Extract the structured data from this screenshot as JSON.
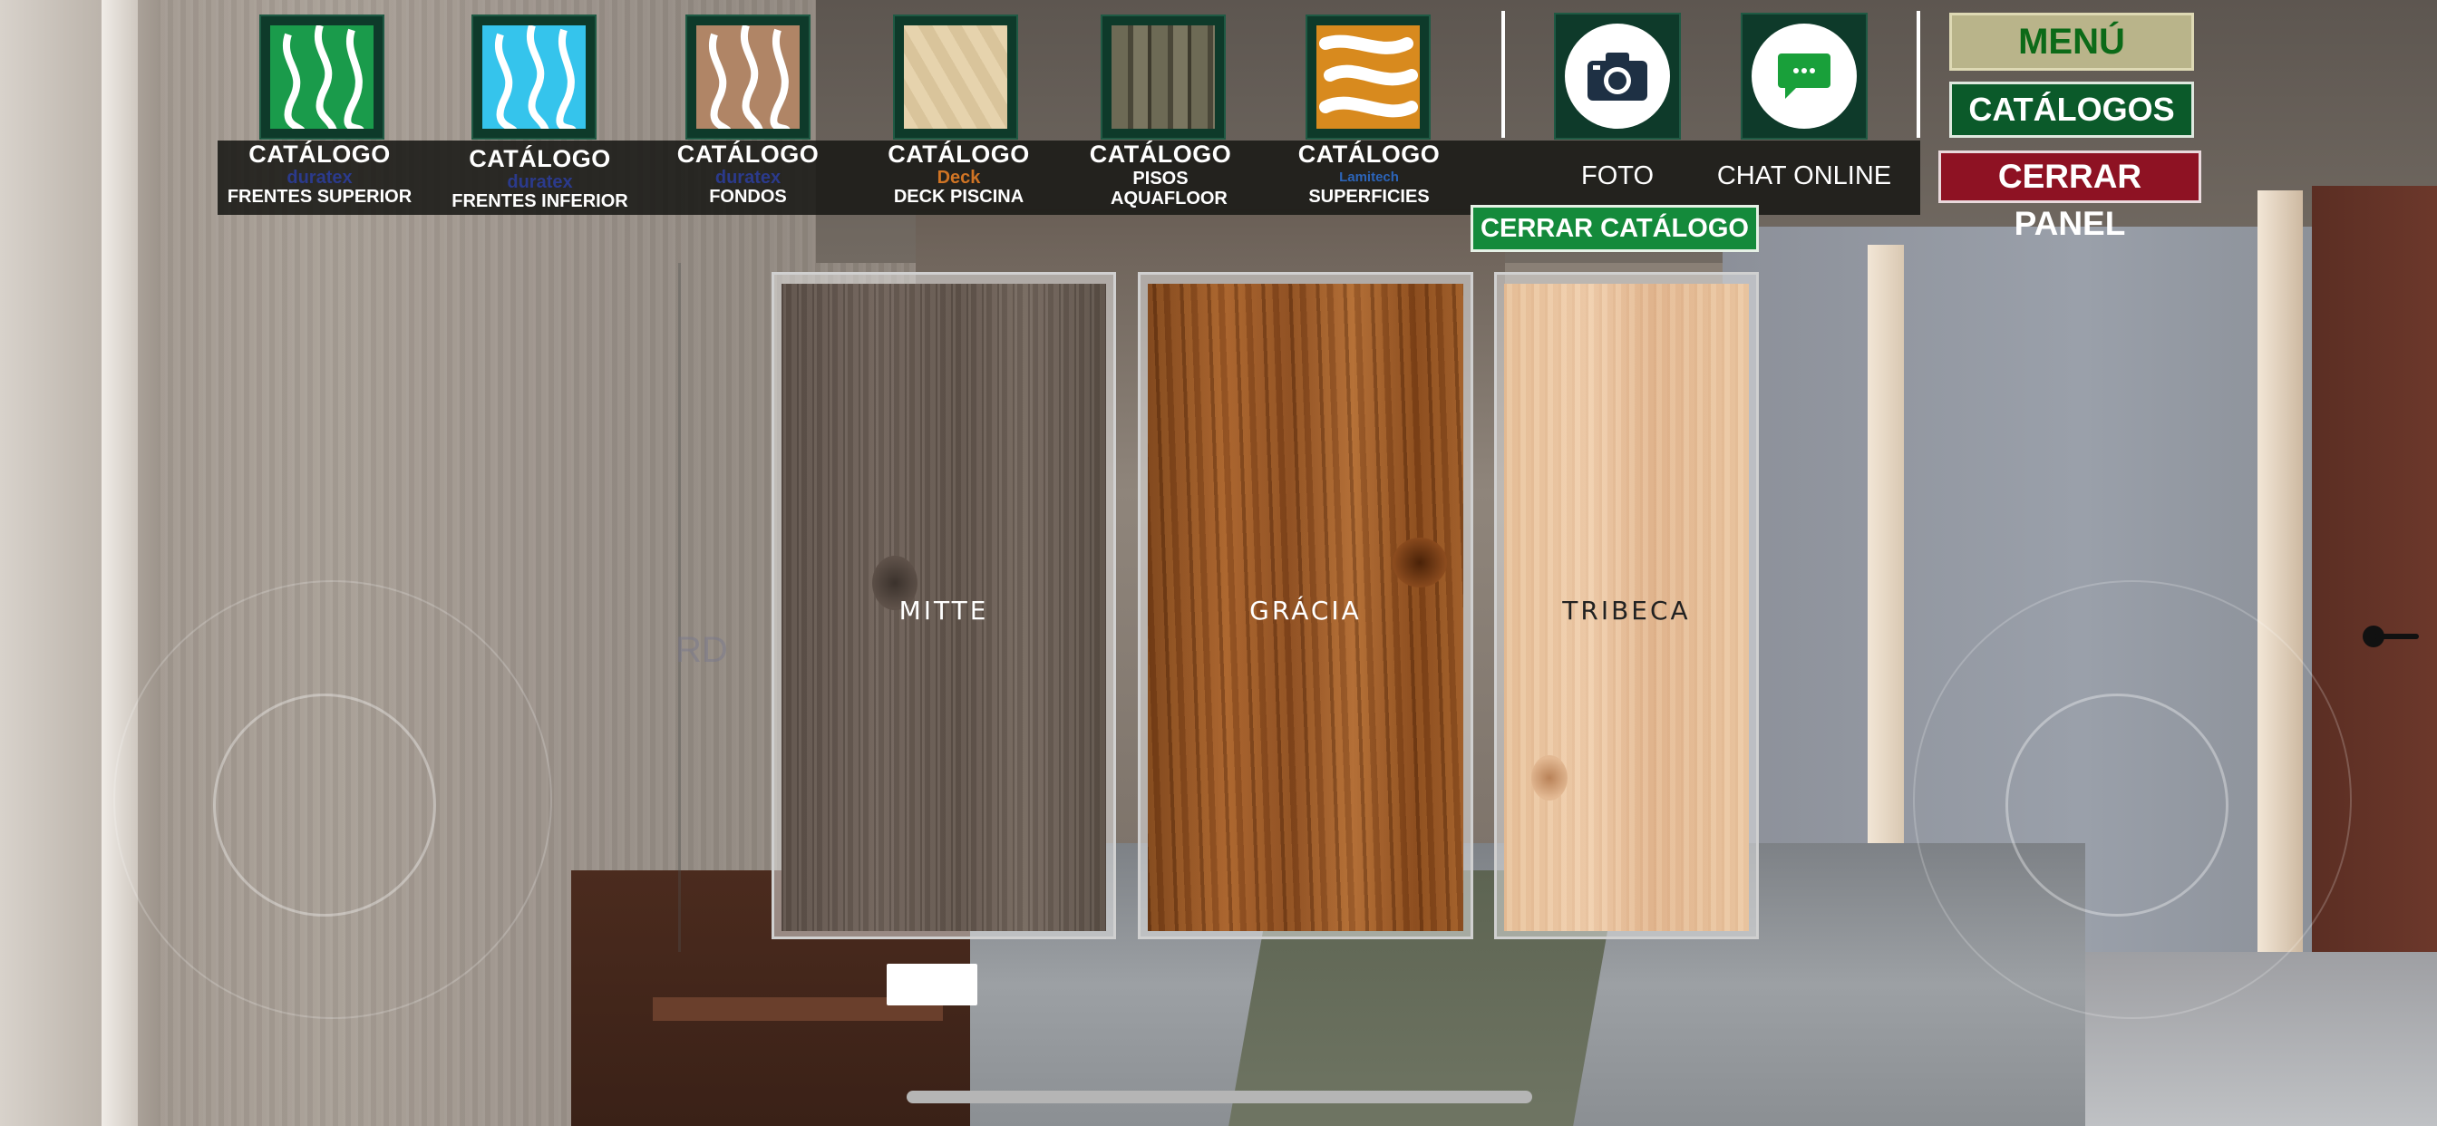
{
  "catalogs": [
    {
      "title": "CATÁLOGO",
      "brand": "duratex",
      "subtitle": "FRENTES SUPERIOR",
      "thumb_color": "#1a9b4b",
      "thumb_pattern": "#ffffff"
    },
    {
      "title": "CATÁLOGO",
      "brand": "duratex",
      "subtitle": "FRENTES INFERIOR",
      "thumb_color": "#35c4ec",
      "thumb_pattern": "#ffffff"
    },
    {
      "title": "CATÁLOGO",
      "brand": "duratex",
      "subtitle": "FONDOS",
      "thumb_color": "#b08566",
      "thumb_pattern": "#ffffff"
    },
    {
      "title": "CATÁLOGO",
      "brand": "Deck",
      "subtitle": "DECK PISCINA",
      "thumb_color": "#e6d3ad",
      "thumb_pattern": "#cdb892"
    },
    {
      "title": "CATÁLOGO",
      "brand": "",
      "subtitle": "PISOS AQUAFLOOR",
      "thumb_color": "#6d6a55",
      "thumb_pattern": "#3d3a2d"
    },
    {
      "title": "CATÁLOGO",
      "brand": "Lamitech",
      "subtitle": "SUPERFICIES",
      "thumb_color": "#d88a1e",
      "thumb_pattern": "#ffffff"
    }
  ],
  "actions": {
    "photo_label": "FOTO",
    "chat_label": "CHAT ONLINE"
  },
  "menu": {
    "menu_label": "MENÚ",
    "catalogs_label": "CATÁLOGOS",
    "close_panel_label": "CERRAR PANEL",
    "close_catalog_label": "CERRAR CATÁLOGO"
  },
  "swatches": [
    {
      "name": "MITTE"
    },
    {
      "name": "GRÁCIA"
    },
    {
      "name": "TRIBECA"
    }
  ],
  "scene": {
    "partial_text": "RD"
  },
  "colors": {
    "thumb_bg": "#0e3a2a",
    "menu_btn": "#b9b48a",
    "catalogs_btn": "#0b5a2a",
    "close_panel_btn": "#8e1223",
    "close_catalog_btn": "#148a3b"
  }
}
